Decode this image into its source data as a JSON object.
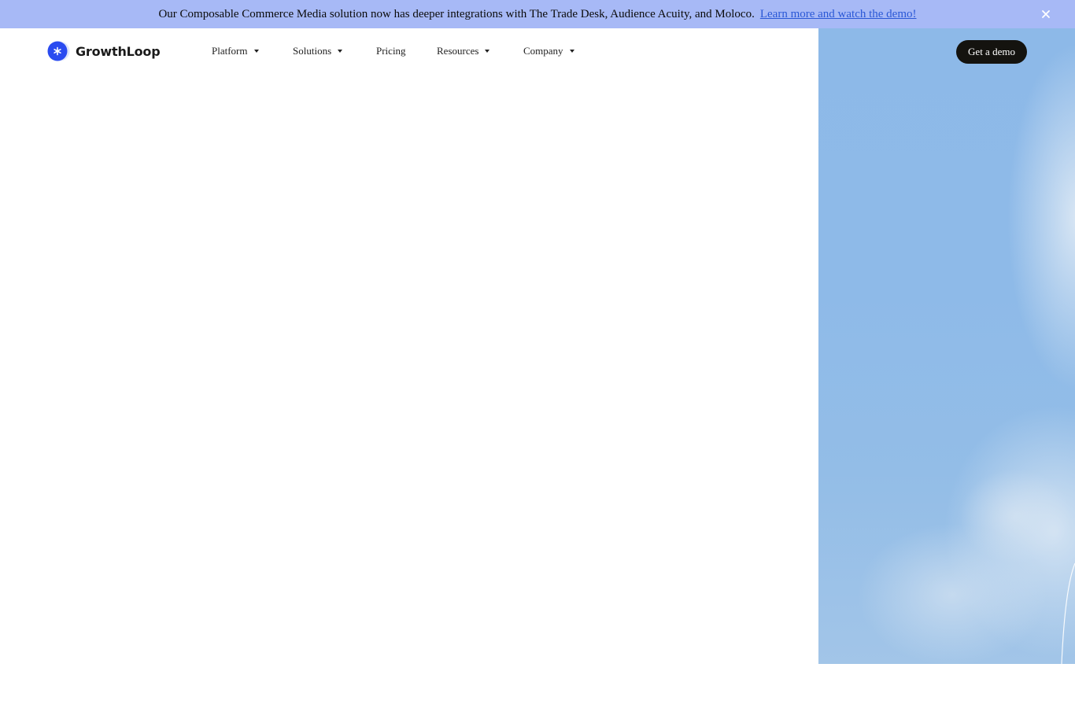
{
  "announcement": {
    "message": "Our Composable Commerce Media solution now has deeper integrations with The Trade Desk, Audience Acuity, and Moloco.",
    "link_label": "Learn more and watch the demo!",
    "close_icon": "close-icon",
    "bg_color": "#a7b9f6",
    "link_color": "#2a58d6"
  },
  "header": {
    "logo_text": "GrowthLoop",
    "logo_icon": "growthloop-logo-icon",
    "brand_color": "#2a4bf0",
    "nav": [
      {
        "label": "Platform",
        "has_dropdown": true
      },
      {
        "label": "Solutions",
        "has_dropdown": true
      },
      {
        "label": "Pricing",
        "has_dropdown": false
      },
      {
        "label": "Resources",
        "has_dropdown": true
      },
      {
        "label": "Company",
        "has_dropdown": true
      }
    ],
    "cta_label": "Get a demo",
    "cta_color": "#14130f"
  },
  "hero": {
    "image": "sky-with-clouds",
    "sky_color": "#8db9e8"
  }
}
